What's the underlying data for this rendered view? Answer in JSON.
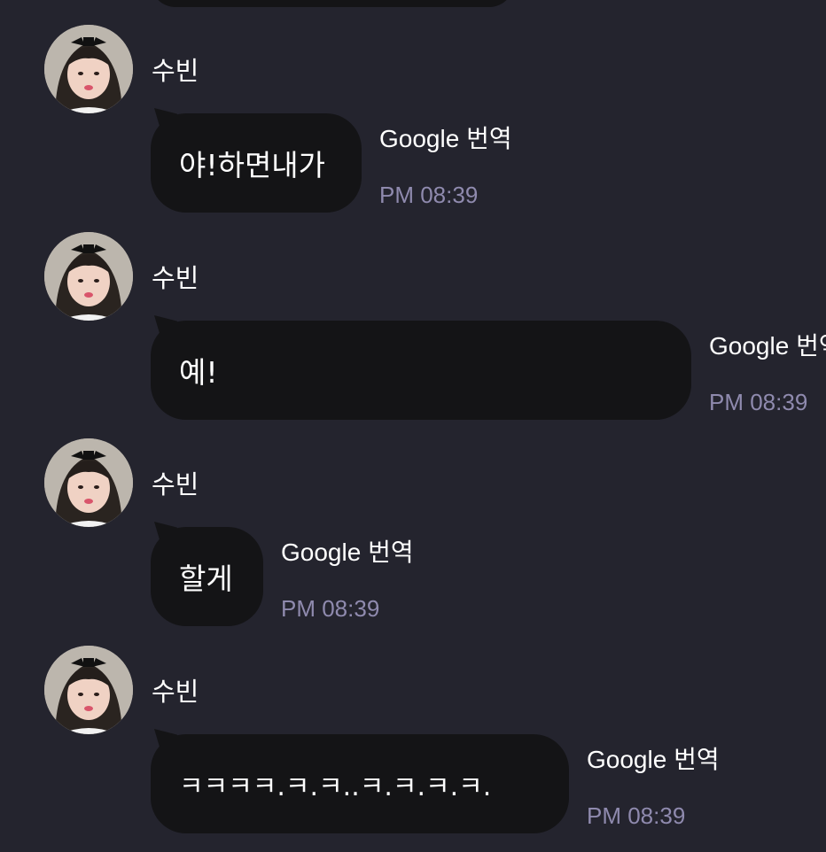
{
  "messages": [
    {
      "sender": "수빈",
      "text": "야!하면내가",
      "translate_label": "Google 번역",
      "time": "PM 08:39"
    },
    {
      "sender": "수빈",
      "text": "예!",
      "translate_label": "Google 번역",
      "time": "PM 08:39"
    },
    {
      "sender": "수빈",
      "text": "할게",
      "translate_label": "Google 번역",
      "time": "PM 08:39"
    },
    {
      "sender": "수빈",
      "text": "ㅋㅋㅋㅋ.ㅋ.ㅋ..ㅋ.ㅋ.ㅋ.ㅋ.",
      "translate_label": "Google 번역",
      "time": "PM 08:39"
    }
  ],
  "colors": {
    "background": "#24242e",
    "bubble": "#141416",
    "text": "#ffffff",
    "timestamp": "#8f8aae"
  }
}
